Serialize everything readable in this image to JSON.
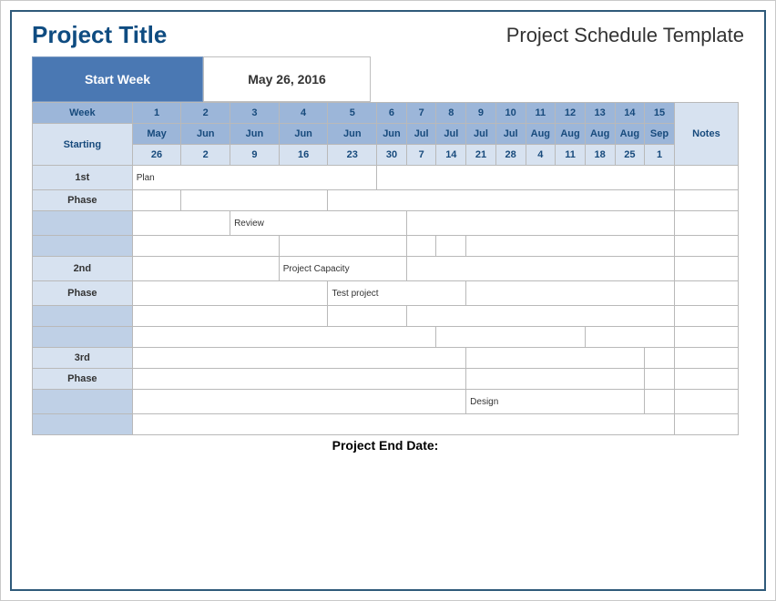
{
  "title": "Project Title",
  "template_title": "Project Schedule Template",
  "start_week_label": "Start Week",
  "start_week_date": "May 26, 2016",
  "headers": {
    "week": "Week",
    "starting": "Starting",
    "notes": "Notes"
  },
  "weeks": [
    "1",
    "2",
    "3",
    "4",
    "5",
    "6",
    "7",
    "8",
    "9",
    "10",
    "11",
    "12",
    "13",
    "14",
    "15"
  ],
  "months": [
    "May",
    "Jun",
    "Jun",
    "Jun",
    "Jun",
    "Jun",
    "Jul",
    "Jul",
    "Jul",
    "Jul",
    "Aug",
    "Aug",
    "Aug",
    "Aug",
    "Sep"
  ],
  "days": [
    "26",
    "2",
    "9",
    "16",
    "23",
    "30",
    "7",
    "14",
    "21",
    "28",
    "4",
    "11",
    "18",
    "25",
    "1"
  ],
  "row_labels": [
    "1st",
    "Phase",
    "",
    "",
    "2nd",
    "Phase",
    "",
    "",
    "3rd",
    "Phase",
    "",
    ""
  ],
  "tasks": {
    "plan": "Plan",
    "review": "Review",
    "capacity": "Project Capacity",
    "test": "Test project",
    "design": "Design"
  },
  "end_label": "Project End Date:",
  "colors": {
    "accent": "#4a78b3",
    "header": "#9cb6d9",
    "sub": "#d7e2f0",
    "bar_blue": "#b9cce6",
    "bar_gray": "#bfbfbf"
  }
}
